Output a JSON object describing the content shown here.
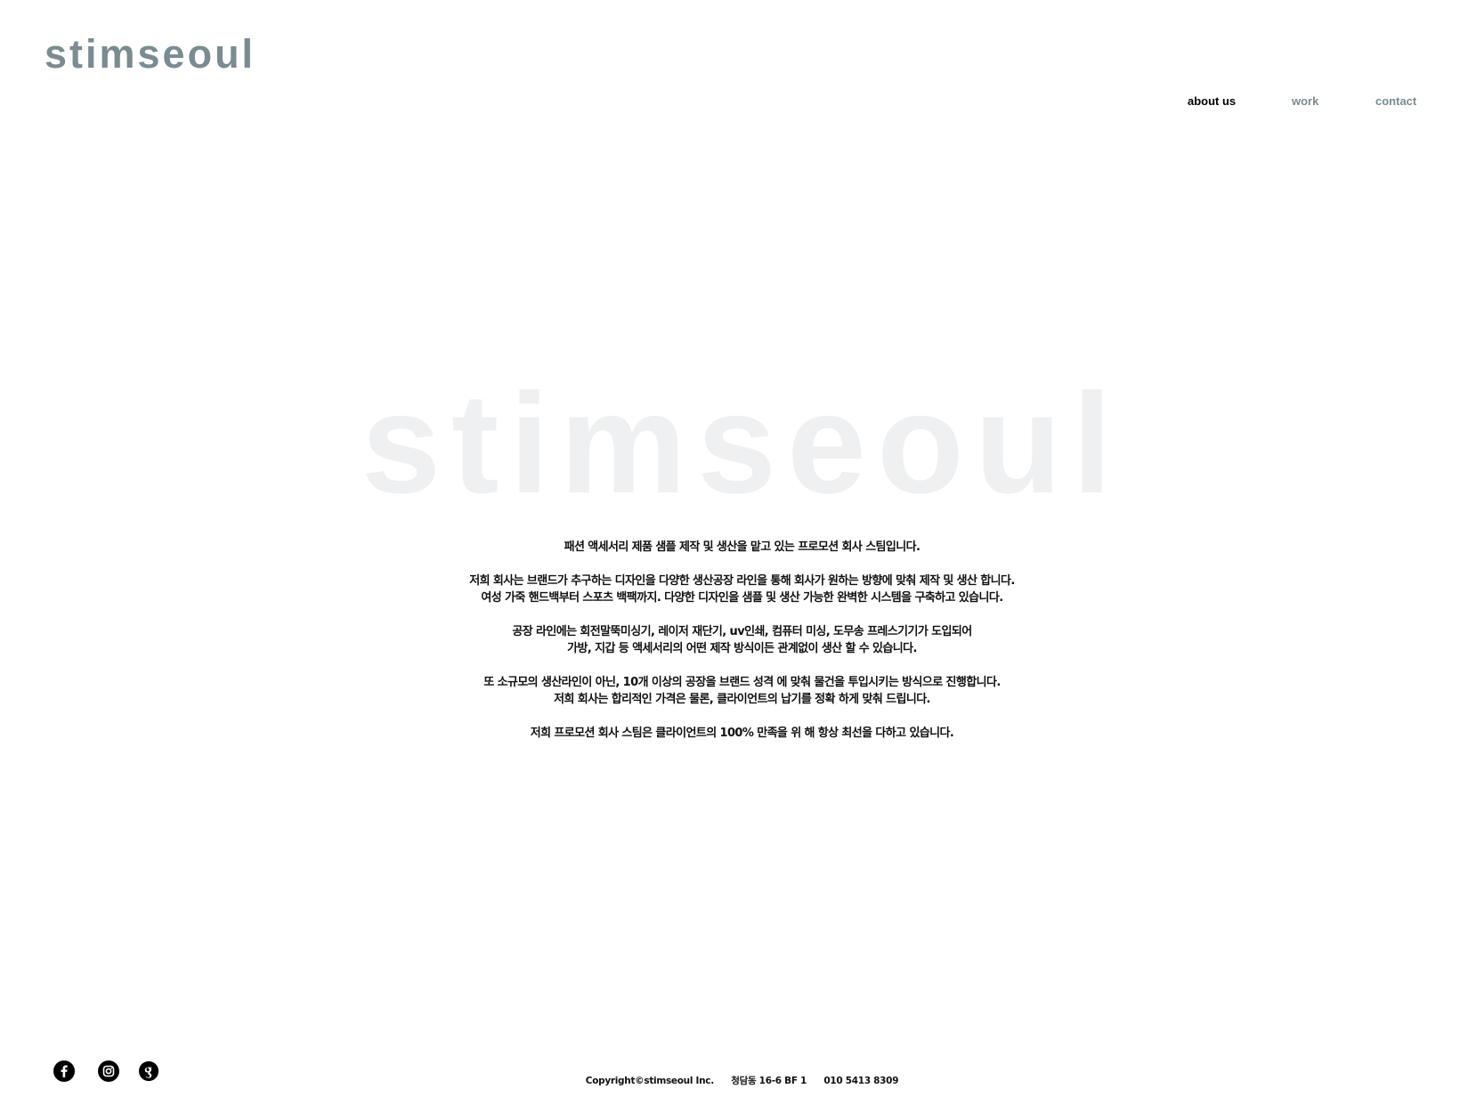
{
  "brand": {
    "logo_text": "stimseoul",
    "watermark_text": "stimseoul"
  },
  "nav": {
    "items": [
      {
        "label": "about us",
        "active": true
      },
      {
        "label": "work",
        "active": false
      },
      {
        "label": "contact",
        "active": false
      }
    ]
  },
  "intro": {
    "paragraphs": [
      [
        "패션 액세서리 제품 샘플 제작 및 생산을 맡고 있는 프로모션 회사 스팀입니다."
      ],
      [
        "저희 회사는 브랜드가 추구하는 디자인을 다양한 생산공장 라인을 통해 회사가 원하는 방향에 맞춰 제작 및 생산 합니다.",
        "여성 가죽 핸드백부터 스포츠 백팩까지. 다양한 디자인을 샘플 및 생산 가능한 완벽한 시스템을 구축하고 있습니다."
      ],
      [
        "공장 라인에는 회전말뚝미싱기, 레이저 재단기, uv인쇄, 컴퓨터 미싱, 도무송 프레스기기가 도입되어",
        "가방, 지갑 등 액세서리의 어떤 제작 방식이든 관계없이 생산 할 수 있습니다."
      ],
      [
        "또 소규모의 생산라인이 아닌, 10개 이상의 공장을 브랜드 성격 에 맞춰 물건을 투입시키는 방식으로 진행합니다.",
        "저희 회사는 합리적인 가격은 물론, 클라이언트의 납기를 정확 하게 맞춰 드립니다."
      ],
      [
        "저희 프로모션 회사 스팀은 클라이언트의 100% 만족을 위 해 항상 최선을 다하고 있습니다."
      ]
    ]
  },
  "social": [
    {
      "name": "facebook-icon",
      "glyph": "f"
    },
    {
      "name": "instagram-icon",
      "glyph": ""
    },
    {
      "name": "google-plus-icon",
      "glyph": "g+"
    }
  ],
  "footer": {
    "copyright": "Copyright©stimseoul Inc.",
    "address": "청담동 16-6 BF 1",
    "phone": "010 5413 8309"
  },
  "colors": {
    "accent": "#7b8b92",
    "watermark": "#eff0f1",
    "text": "#111111"
  }
}
